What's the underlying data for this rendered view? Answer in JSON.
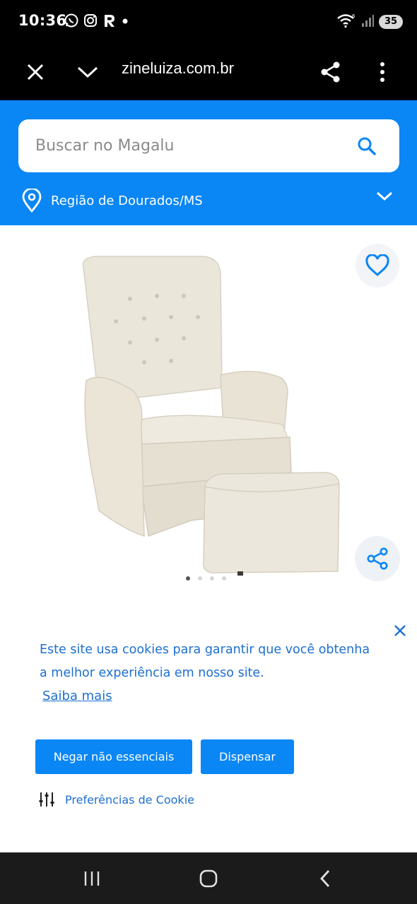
{
  "status_bar": {
    "time": "10:36",
    "battery": "35",
    "left_icons": [
      "whatsapp-icon",
      "instagram-icon",
      "r-app-icon",
      "dot-icon"
    ],
    "right_icons": [
      "wifi-icon",
      "signal-icon",
      "battery-icon"
    ]
  },
  "browser": {
    "url": "zineluiza.com.br",
    "icons": [
      "close-icon",
      "chevron-down-icon",
      "share-icon",
      "more-vert-icon"
    ]
  },
  "header": {
    "search_placeholder": "Buscar no Magalu",
    "region": "Região de Dourados/MS",
    "accent": "#0a86f5"
  },
  "product": {
    "image_alt": "",
    "carousel_total": 4,
    "carousel_active": 1
  },
  "cookie": {
    "text": "Este site usa cookies para garantir que você obtenha a melhor experiência em nosso site.",
    "link": "Saiba mais",
    "deny_button": "Negar não essenciais",
    "dismiss_button": "Dispensar",
    "preferences": "Preferências de Cookie",
    "text_color": "#1d6fd0"
  },
  "nav": {
    "icons": [
      "recent-apps-icon",
      "home-icon",
      "back-icon"
    ]
  }
}
